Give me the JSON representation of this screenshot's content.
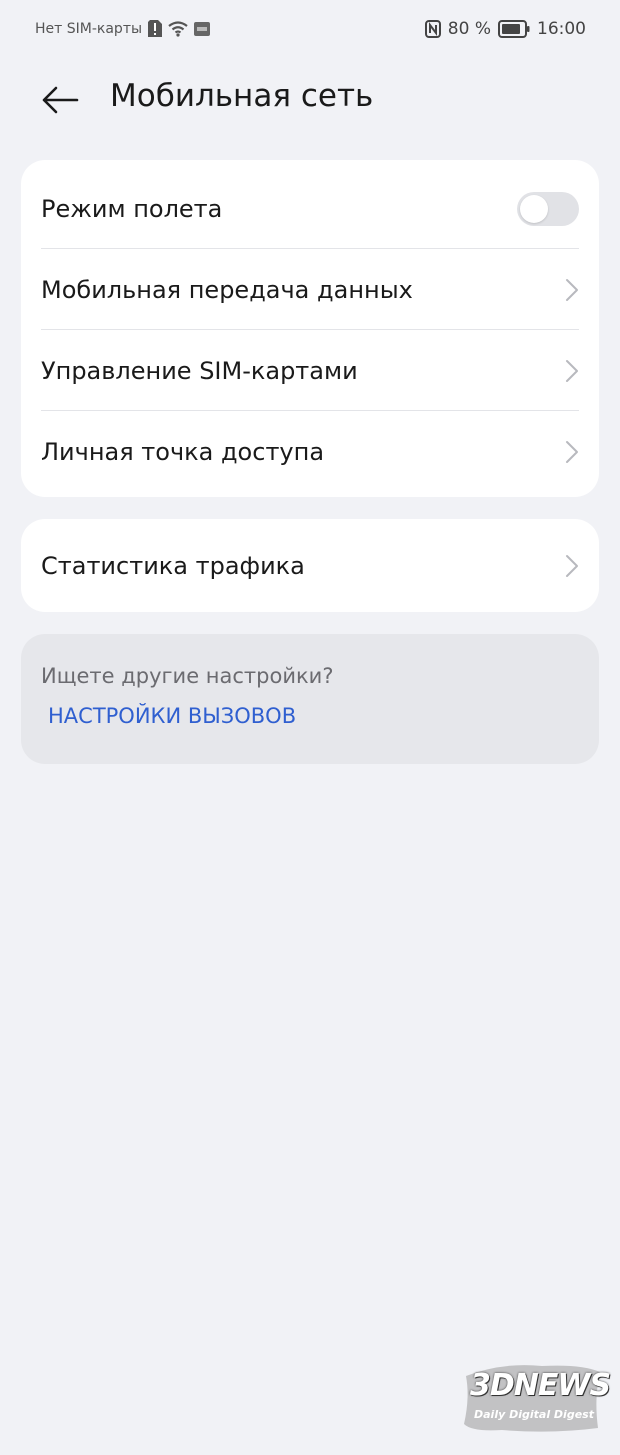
{
  "status_bar": {
    "carrier": "Нет SIM-карты",
    "battery_percent": "80 %",
    "time": "16:00",
    "icons": [
      "sim-alert-icon",
      "wifi-icon",
      "hd-icon",
      "nfc-icon",
      "battery-icon"
    ]
  },
  "header": {
    "title": "Мобильная сеть",
    "back_icon": "arrow-left-icon"
  },
  "settings_group_1": {
    "airplane_mode": {
      "label": "Режим полета",
      "enabled": false
    },
    "mobile_data": {
      "label": "Мобильная передача данных"
    },
    "sim_management": {
      "label": "Управление SIM-картами"
    },
    "hotspot": {
      "label": "Личная точка доступа"
    }
  },
  "settings_group_2": {
    "traffic_stats": {
      "label": "Статистика трафика"
    }
  },
  "suggestion": {
    "text": "Ищете другие настройки?",
    "link": "НАСТРОЙКИ ВЫЗОВОВ"
  },
  "watermark": {
    "brand": "3DNEWS",
    "tagline": "Daily Digital Digest"
  },
  "colors": {
    "background": "#f1f2f6",
    "card": "#ffffff",
    "suggestion_card": "#e6e7eb",
    "link": "#2f5fd0",
    "toggle_off": "#e1e2e6"
  }
}
